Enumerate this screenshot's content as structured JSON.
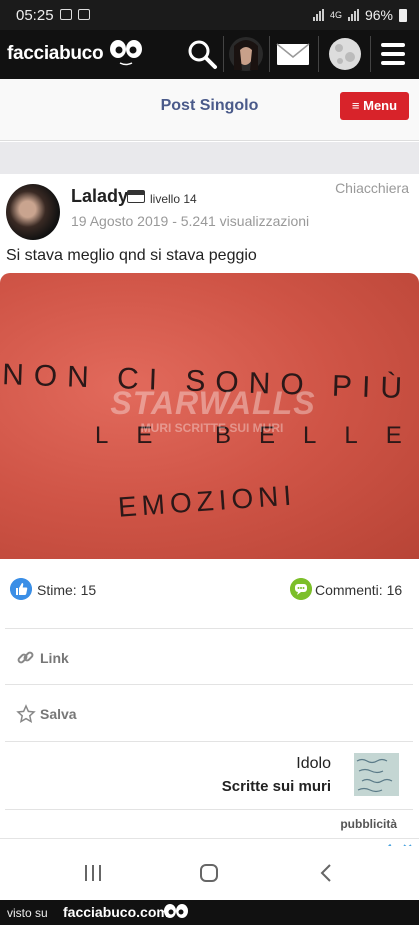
{
  "status": {
    "time": "05:25",
    "network": "4G",
    "battery": "96%"
  },
  "header": {
    "logo": "facciabuco"
  },
  "subheader": {
    "title": "Post Singolo",
    "menu_label": "≡ Menu"
  },
  "post": {
    "author": "Lalady",
    "level": "livello 14",
    "meta": "19 Agosto 2019 - 5.241 visualizzazioni",
    "category": "Chiacchiera",
    "text": "Si stava meglio qnd si stava peggio",
    "image_lines": [
      "NON CI SONO PIÙ",
      "LE BELLE",
      "EMOZIONI"
    ],
    "image_watermark": "STARWALLS",
    "image_watermark_sub": "MURI SCRITTE SUI MURI"
  },
  "actions": {
    "likes": "Stime: 15",
    "comments": "Commenti: 16",
    "link": "Link",
    "save": "Salva"
  },
  "related": {
    "title": "Idolo",
    "subtitle": "Scritte sui muri"
  },
  "ad": {
    "label": "pubblicità"
  },
  "footer": {
    "seen_on": "visto su",
    "brand": "facciabuco.com"
  }
}
